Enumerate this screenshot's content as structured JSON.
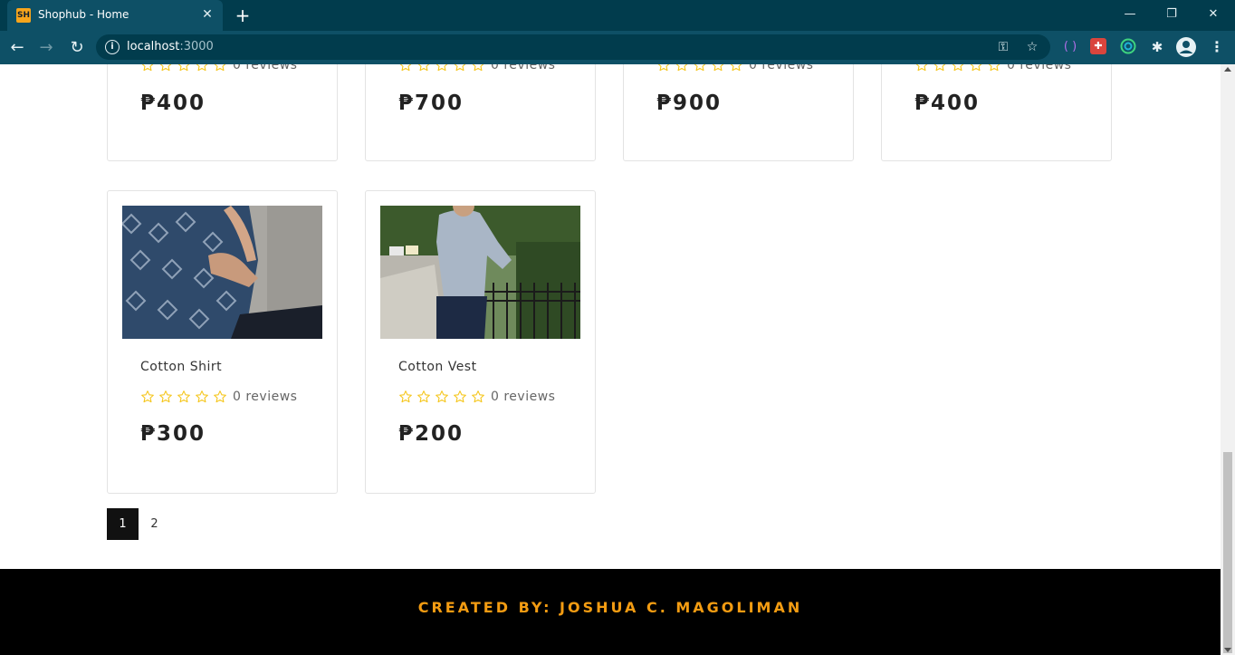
{
  "browser": {
    "favicon_text": "SH",
    "tab_title": "Shophub - Home",
    "url_host": "localhost",
    "url_port": ":3000"
  },
  "colors": {
    "chrome_dark": "#013c4d",
    "chrome_mid": "#0e5066",
    "star": "#f5c518",
    "footer_text": "#f39c12"
  },
  "products_top_row": [
    {
      "reviews": "0 reviews",
      "price": "₱400"
    },
    {
      "reviews": "0 reviews",
      "price": "₱700"
    },
    {
      "reviews": "0 reviews",
      "price": "₱900"
    },
    {
      "reviews": "0 reviews",
      "price": "₱400"
    }
  ],
  "products_bottom_row": [
    {
      "name": "Cotton Shirt",
      "reviews": "0 reviews",
      "price": "₱300",
      "rating": 0
    },
    {
      "name": "Cotton Vest",
      "reviews": "0 reviews",
      "price": "₱200",
      "rating": 0
    }
  ],
  "pagination": {
    "pages": [
      "1",
      "2"
    ],
    "active": "1"
  },
  "footer": {
    "text": "CREATED BY: JOSHUA C. MAGOLIMAN"
  }
}
